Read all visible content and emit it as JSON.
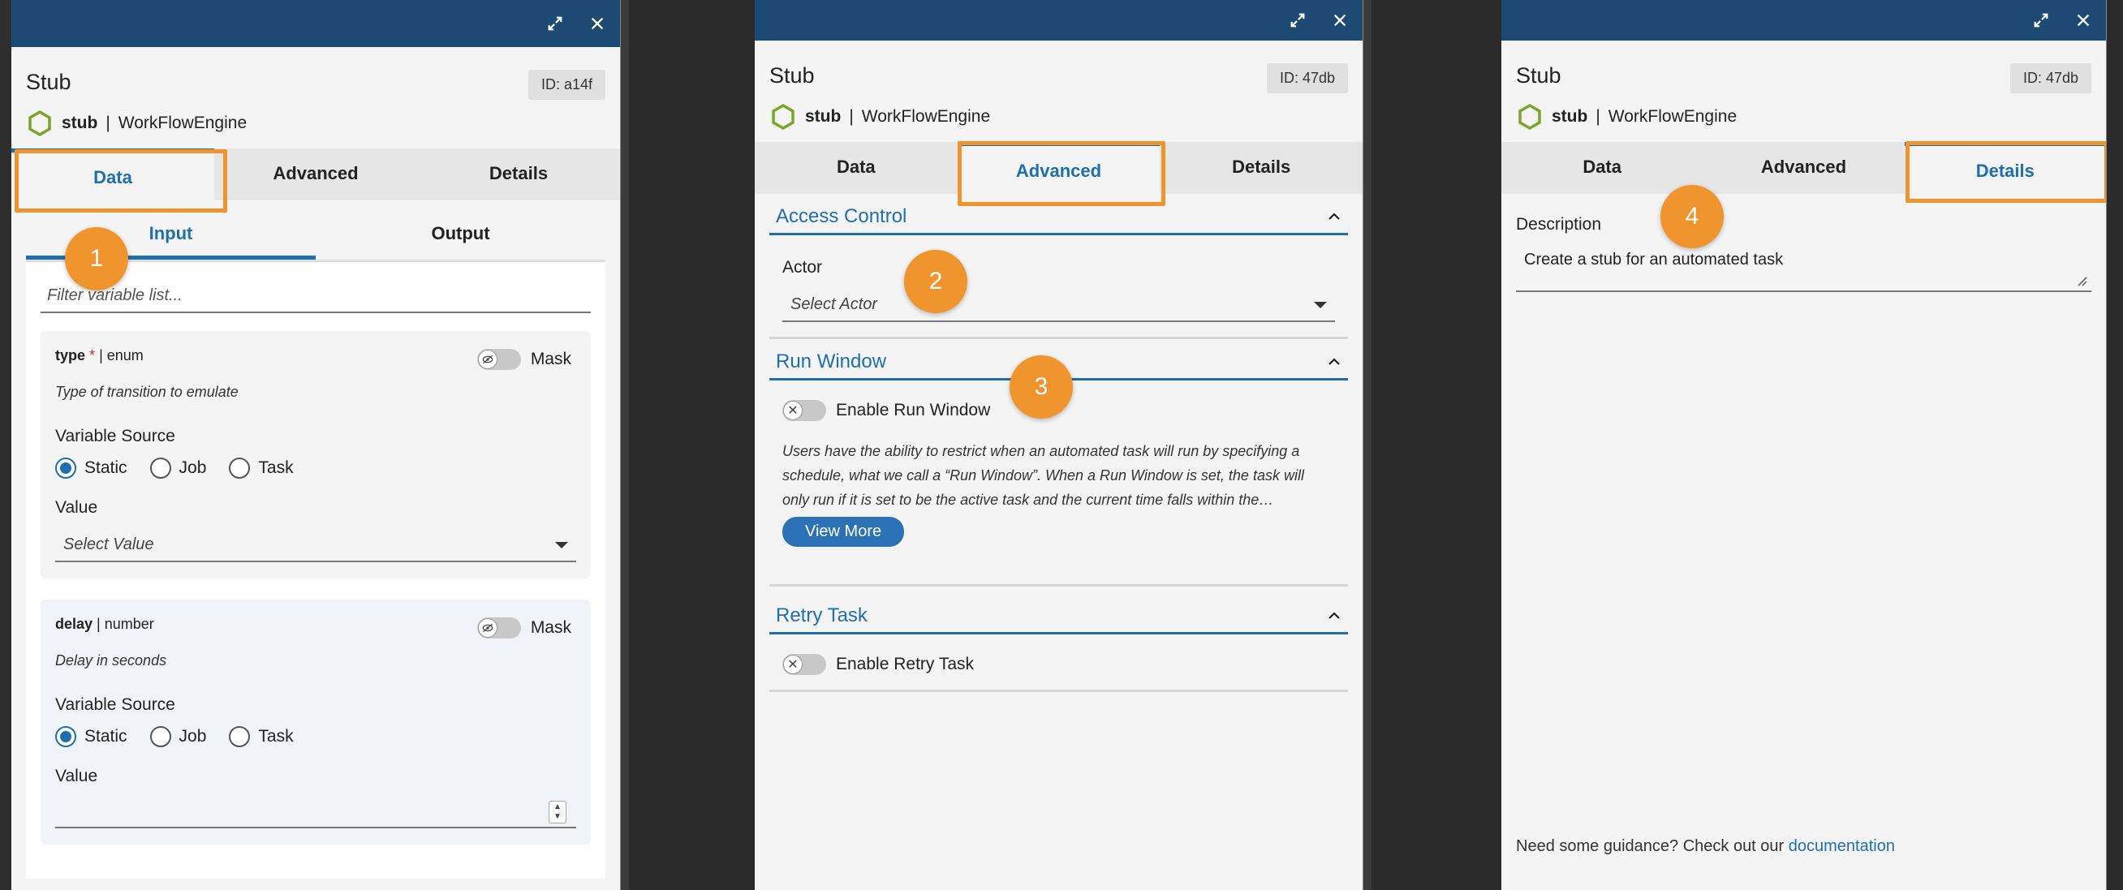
{
  "panels": [
    {
      "title": "Stub",
      "id_label": "ID: a14f",
      "engine_name": "stub",
      "engine_sep": "|",
      "engine_type": "WorkFlowEngine",
      "tabs": [
        "Data",
        "Advanced",
        "Details"
      ],
      "active_tab": "Data"
    },
    {
      "title": "Stub",
      "id_label": "ID: 47db",
      "engine_name": "stub",
      "engine_sep": "|",
      "engine_type": "WorkFlowEngine",
      "tabs": [
        "Data",
        "Advanced",
        "Details"
      ],
      "active_tab": "Advanced"
    },
    {
      "title": "Stub",
      "id_label": "ID: 47db",
      "engine_name": "stub",
      "engine_sep": "|",
      "engine_type": "WorkFlowEngine",
      "tabs": [
        "Data",
        "Advanced",
        "Details"
      ],
      "active_tab": "Details"
    }
  ],
  "markers": [
    "1",
    "2",
    "3",
    "4"
  ],
  "data_tab": {
    "subtabs": [
      "Input",
      "Output"
    ],
    "filter_placeholder": "Filter variable list...",
    "variables": [
      {
        "name": "type",
        "required": "*",
        "type_text": "| enum",
        "mask_label": "Mask",
        "description": "Type of transition to emulate",
        "source_label": "Variable Source",
        "sources": [
          "Static",
          "Job",
          "Task"
        ],
        "selected_source": "Static",
        "value_label": "Value",
        "value_placeholder": "Select Value"
      },
      {
        "name": "delay",
        "type_text": "| number",
        "mask_label": "Mask",
        "description": "Delay in seconds",
        "source_label": "Variable Source",
        "sources": [
          "Static",
          "Job",
          "Task"
        ],
        "selected_source": "Static",
        "value_label": "Value"
      }
    ]
  },
  "advanced_tab": {
    "access_control": {
      "heading": "Access Control",
      "actor_label": "Actor",
      "actor_placeholder": "Select Actor"
    },
    "run_window": {
      "heading": "Run Window",
      "toggle_label": "Enable Run Window",
      "paragraph_1": "Users have the ability to restrict when an automated task will run by specifying a",
      "paragraph_2": "schedule, what we call a “Run Window”. When a Run Window is set, the task will",
      "paragraph_3": "only run if it is set to be the active task and the current time falls within the…",
      "view_more": "View More"
    },
    "retry_task": {
      "heading": "Retry Task",
      "toggle_label": "Enable Retry Task"
    }
  },
  "details_tab": {
    "description_label": "Description",
    "description_value": "Create a stub for an automated task",
    "guidance_text": "Need some guidance? Check out our",
    "guidance_link": "documentation"
  },
  "colors": {
    "titlebar": "#1c4a73",
    "accent": "#1f6fae",
    "highlight": "#f0952e"
  }
}
